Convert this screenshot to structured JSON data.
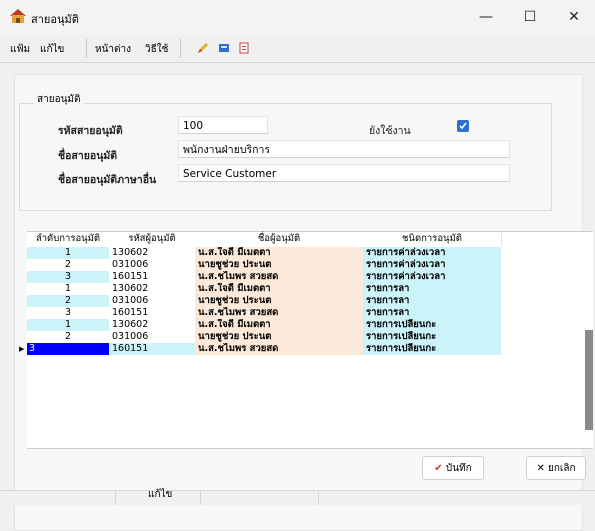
{
  "window": {
    "title": "สายอนุมัติ",
    "minimize": "—",
    "maximize": "☐",
    "close": "✕"
  },
  "menu": {
    "items": [
      "แฟ้ม",
      "แก้ไข",
      "หน้าต่าง",
      "วิธีใช้"
    ]
  },
  "toolbar": {
    "icons": [
      "pencil-icon",
      "save-icon",
      "document-icon"
    ]
  },
  "form": {
    "group_title": "สายอนุมัติ",
    "code_label": "รหัสสายอนุมัติ",
    "code_value": "100",
    "active_label": "ยังใช้งาน",
    "active_checked": true,
    "name_label": "ชื่อสายอนุมัติ",
    "name_value": "พนักงานฝ่ายบริการ",
    "name_other_label": "ชื่อสายอนุมัติภาษาอื่น",
    "name_other_value": "Service Customer"
  },
  "grid": {
    "headers": [
      "ลำดับการอนุมัติ",
      "รหัสผู้อนุมัติ",
      "ชื่อผู้อนุมัติ",
      "ชนิดการอนุมัติ"
    ],
    "rows": [
      {
        "seq": "1",
        "id": "130602",
        "name": "น.ส.ใจดี มีเมตตา",
        "type": "รายการค่าล่วงเวลา"
      },
      {
        "seq": "2",
        "id": "031006",
        "name": "นายชูช่วย ประนต",
        "type": "รายการค่าล่วงเวลา"
      },
      {
        "seq": "3",
        "id": "160151",
        "name": "น.ส.ชไมพร สวยสด",
        "type": "รายการค่าล่วงเวลา"
      },
      {
        "seq": "1",
        "id": "130602",
        "name": "น.ส.ใจดี มีเมตตา",
        "type": "รายการลา"
      },
      {
        "seq": "2",
        "id": "031006",
        "name": "นายชูช่วย ประนต",
        "type": "รายการลา"
      },
      {
        "seq": "3",
        "id": "160151",
        "name": "น.ส.ชไมพร สวยสด",
        "type": "รายการลา"
      },
      {
        "seq": "1",
        "id": "130602",
        "name": "น.ส.ใจดี มีเมตตา",
        "type": "รายการเปลี่ยนกะ"
      },
      {
        "seq": "2",
        "id": "031006",
        "name": "นายชูช่วย ประนต",
        "type": "รายการเปลี่ยนกะ"
      },
      {
        "seq": "3",
        "id": "160151",
        "name": "น.ส.ชไมพร สวยสด",
        "type": "รายการเปลี่ยนกะ"
      }
    ],
    "row_marker": "▶"
  },
  "buttons": {
    "save": "✔ บันทึก",
    "cancel": "✕ ยกเลิก"
  },
  "status": {
    "mode": "แก้ไข"
  },
  "colors": {
    "accent": "#2f6fcf",
    "name_cell": "#fde9d9",
    "type_cell": "#ccf2fa",
    "selection": "#0000ff"
  }
}
